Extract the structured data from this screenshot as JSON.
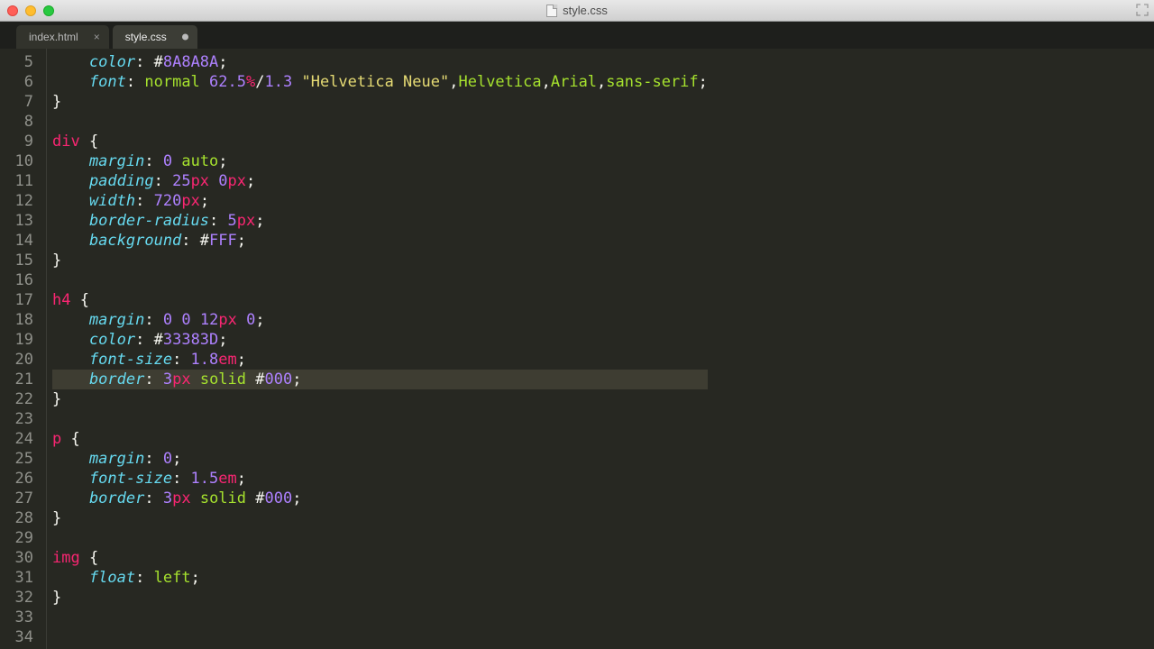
{
  "window": {
    "title": "style.css"
  },
  "tabs": [
    {
      "label": "index.html",
      "dirty": false
    },
    {
      "label": "style.css",
      "dirty": true
    }
  ],
  "gutter": {
    "start": 5,
    "end": 34
  },
  "active_line": 21,
  "code_lines": [
    [
      {
        "t": "prop",
        "s": "    color"
      },
      {
        "t": "punct",
        "s": ": "
      },
      {
        "t": "punct",
        "s": "#"
      },
      {
        "t": "hex",
        "s": "8A8A8A"
      },
      {
        "t": "punct",
        "s": ";"
      }
    ],
    [
      {
        "t": "prop",
        "s": "    font"
      },
      {
        "t": "punct",
        "s": ": "
      },
      {
        "t": "id",
        "s": "normal"
      },
      {
        "t": "punct",
        "s": " "
      },
      {
        "t": "num",
        "s": "62.5"
      },
      {
        "t": "unit",
        "s": "%"
      },
      {
        "t": "punct",
        "s": "/"
      },
      {
        "t": "num",
        "s": "1.3"
      },
      {
        "t": "punct",
        "s": " "
      },
      {
        "t": "str",
        "s": "\"Helvetica Neue\""
      },
      {
        "t": "punct",
        "s": ","
      },
      {
        "t": "id",
        "s": "Helvetica"
      },
      {
        "t": "punct",
        "s": ","
      },
      {
        "t": "id",
        "s": "Arial"
      },
      {
        "t": "punct",
        "s": ","
      },
      {
        "t": "id",
        "s": "sans-serif"
      },
      {
        "t": "punct",
        "s": ";"
      }
    ],
    [
      {
        "t": "punct",
        "s": "}"
      }
    ],
    [],
    [
      {
        "t": "sel",
        "s": "div"
      },
      {
        "t": "punct",
        "s": " {"
      }
    ],
    [
      {
        "t": "prop",
        "s": "    margin"
      },
      {
        "t": "punct",
        "s": ": "
      },
      {
        "t": "num",
        "s": "0"
      },
      {
        "t": "punct",
        "s": " "
      },
      {
        "t": "id",
        "s": "auto"
      },
      {
        "t": "punct",
        "s": ";"
      }
    ],
    [
      {
        "t": "prop",
        "s": "    padding"
      },
      {
        "t": "punct",
        "s": ": "
      },
      {
        "t": "num",
        "s": "25"
      },
      {
        "t": "unit",
        "s": "px"
      },
      {
        "t": "punct",
        "s": " "
      },
      {
        "t": "num",
        "s": "0"
      },
      {
        "t": "unit",
        "s": "px"
      },
      {
        "t": "punct",
        "s": ";"
      }
    ],
    [
      {
        "t": "prop",
        "s": "    width"
      },
      {
        "t": "punct",
        "s": ": "
      },
      {
        "t": "num",
        "s": "720"
      },
      {
        "t": "unit",
        "s": "px"
      },
      {
        "t": "punct",
        "s": ";"
      }
    ],
    [
      {
        "t": "prop",
        "s": "    border-radius"
      },
      {
        "t": "punct",
        "s": ": "
      },
      {
        "t": "num",
        "s": "5"
      },
      {
        "t": "unit",
        "s": "px"
      },
      {
        "t": "punct",
        "s": ";"
      }
    ],
    [
      {
        "t": "prop",
        "s": "    background"
      },
      {
        "t": "punct",
        "s": ": "
      },
      {
        "t": "punct",
        "s": "#"
      },
      {
        "t": "hex",
        "s": "FFF"
      },
      {
        "t": "punct",
        "s": ";"
      }
    ],
    [
      {
        "t": "punct",
        "s": "}"
      }
    ],
    [],
    [
      {
        "t": "sel",
        "s": "h4"
      },
      {
        "t": "punct",
        "s": " {"
      }
    ],
    [
      {
        "t": "prop",
        "s": "    margin"
      },
      {
        "t": "punct",
        "s": ": "
      },
      {
        "t": "num",
        "s": "0"
      },
      {
        "t": "punct",
        "s": " "
      },
      {
        "t": "num",
        "s": "0"
      },
      {
        "t": "punct",
        "s": " "
      },
      {
        "t": "num",
        "s": "12"
      },
      {
        "t": "unit",
        "s": "px"
      },
      {
        "t": "punct",
        "s": " "
      },
      {
        "t": "num",
        "s": "0"
      },
      {
        "t": "punct",
        "s": ";"
      }
    ],
    [
      {
        "t": "prop",
        "s": "    color"
      },
      {
        "t": "punct",
        "s": ": "
      },
      {
        "t": "punct",
        "s": "#"
      },
      {
        "t": "hex",
        "s": "33383D"
      },
      {
        "t": "punct",
        "s": ";"
      }
    ],
    [
      {
        "t": "prop",
        "s": "    font-size"
      },
      {
        "t": "punct",
        "s": ": "
      },
      {
        "t": "num",
        "s": "1.8"
      },
      {
        "t": "unit",
        "s": "em"
      },
      {
        "t": "punct",
        "s": ";"
      }
    ],
    [
      {
        "t": "prop",
        "s": "    border"
      },
      {
        "t": "punct",
        "s": ": "
      },
      {
        "t": "num",
        "s": "3"
      },
      {
        "t": "unit",
        "s": "px"
      },
      {
        "t": "punct",
        "s": " "
      },
      {
        "t": "id",
        "s": "solid"
      },
      {
        "t": "punct",
        "s": " #"
      },
      {
        "t": "hex",
        "s": "000"
      },
      {
        "t": "punct",
        "s": ";"
      }
    ],
    [
      {
        "t": "punct",
        "s": "}"
      }
    ],
    [],
    [
      {
        "t": "sel",
        "s": "p"
      },
      {
        "t": "punct",
        "s": " {"
      }
    ],
    [
      {
        "t": "prop",
        "s": "    margin"
      },
      {
        "t": "punct",
        "s": ": "
      },
      {
        "t": "num",
        "s": "0"
      },
      {
        "t": "punct",
        "s": ";"
      }
    ],
    [
      {
        "t": "prop",
        "s": "    font-size"
      },
      {
        "t": "punct",
        "s": ": "
      },
      {
        "t": "num",
        "s": "1.5"
      },
      {
        "t": "unit",
        "s": "em"
      },
      {
        "t": "punct",
        "s": ";"
      }
    ],
    [
      {
        "t": "prop",
        "s": "    border"
      },
      {
        "t": "punct",
        "s": ": "
      },
      {
        "t": "num",
        "s": "3"
      },
      {
        "t": "unit",
        "s": "px"
      },
      {
        "t": "punct",
        "s": " "
      },
      {
        "t": "id",
        "s": "solid"
      },
      {
        "t": "punct",
        "s": " #"
      },
      {
        "t": "hex",
        "s": "000"
      },
      {
        "t": "punct",
        "s": ";"
      }
    ],
    [
      {
        "t": "punct",
        "s": "}"
      }
    ],
    [],
    [
      {
        "t": "sel",
        "s": "img"
      },
      {
        "t": "punct",
        "s": " {"
      }
    ],
    [
      {
        "t": "prop",
        "s": "    float"
      },
      {
        "t": "punct",
        "s": ": "
      },
      {
        "t": "id",
        "s": "left"
      },
      {
        "t": "punct",
        "s": ";"
      }
    ],
    [
      {
        "t": "punct",
        "s": "}"
      }
    ],
    [],
    []
  ]
}
